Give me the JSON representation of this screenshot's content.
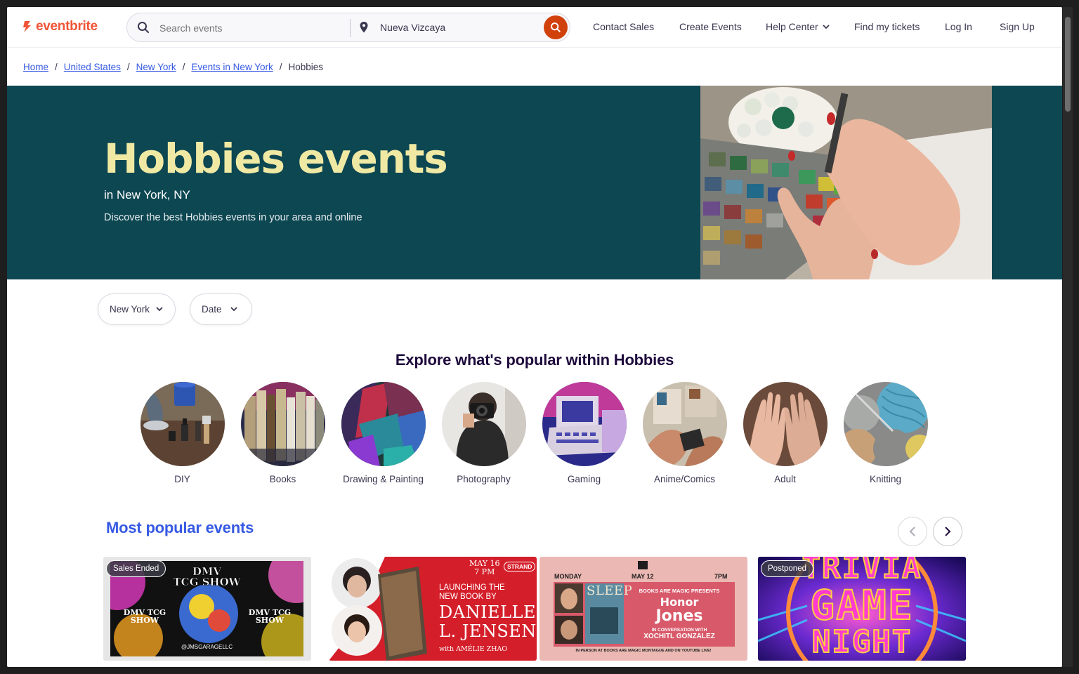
{
  "header": {
    "logo_text": "eventbrite",
    "search_placeholder": "Search events",
    "location": "Nueva Vizcaya",
    "nav": {
      "contact_sales": "Contact Sales",
      "create_events": "Create Events",
      "help_center": "Help Center",
      "find_tickets": "Find my tickets",
      "log_in": "Log In",
      "sign_up": "Sign Up"
    }
  },
  "breadcrumb": {
    "items": [
      "Home",
      "United States",
      "New York",
      "Events in New York"
    ],
    "current": "Hobbies"
  },
  "hero": {
    "title": "Hobbies events",
    "subtitle": "in New York, NY",
    "description": "Discover the best Hobbies events in your area and online"
  },
  "filters": {
    "location": "New York",
    "date": "Date"
  },
  "explore": {
    "title": "Explore what's popular within Hobbies",
    "categories": [
      "DIY",
      "Books",
      "Drawing & Painting",
      "Photography",
      "Gaming",
      "Anime/Comics",
      "Adult",
      "Knitting"
    ]
  },
  "popular": {
    "title": "Most popular events",
    "cards": [
      {
        "badge": "Sales Ended",
        "line1": "DMV",
        "line2": "TCG SHOW",
        "side": "DMV TCG SHOW",
        "handle": "@JMSGARAGELLC"
      },
      {
        "date": "MAY 16",
        "time": "7 PM",
        "brand": "STRAND",
        "launch": "LAUNCHING THE NEW BOOK BY",
        "author1": "DANIELLE",
        "author2": "L. JENSEN",
        "with": "with AMÉLIE ZHAO"
      },
      {
        "day": "MONDAY",
        "date": "MAY 12",
        "time": "7PM",
        "book": "SLEEP",
        "presents": "BOOKS ARE MAGIC PRESENTS",
        "name1": "Honor",
        "name2": "Jones",
        "conv": "IN CONVERSATION WITH",
        "guest": "XOCHITL GONZALEZ",
        "footer": "IN PERSON AT BOOKS ARE MAGIC MONTAGUE AND ON YOUTUBE LIVE!"
      },
      {
        "badge": "Postponed",
        "line1": "TRIVIA",
        "line2": "GAME",
        "line3": "NIGHT"
      }
    ]
  },
  "colors": {
    "brand": "#f05537",
    "hero_bg": "#0d4752",
    "hero_title": "#f0e9a4",
    "link": "#3659e3"
  }
}
